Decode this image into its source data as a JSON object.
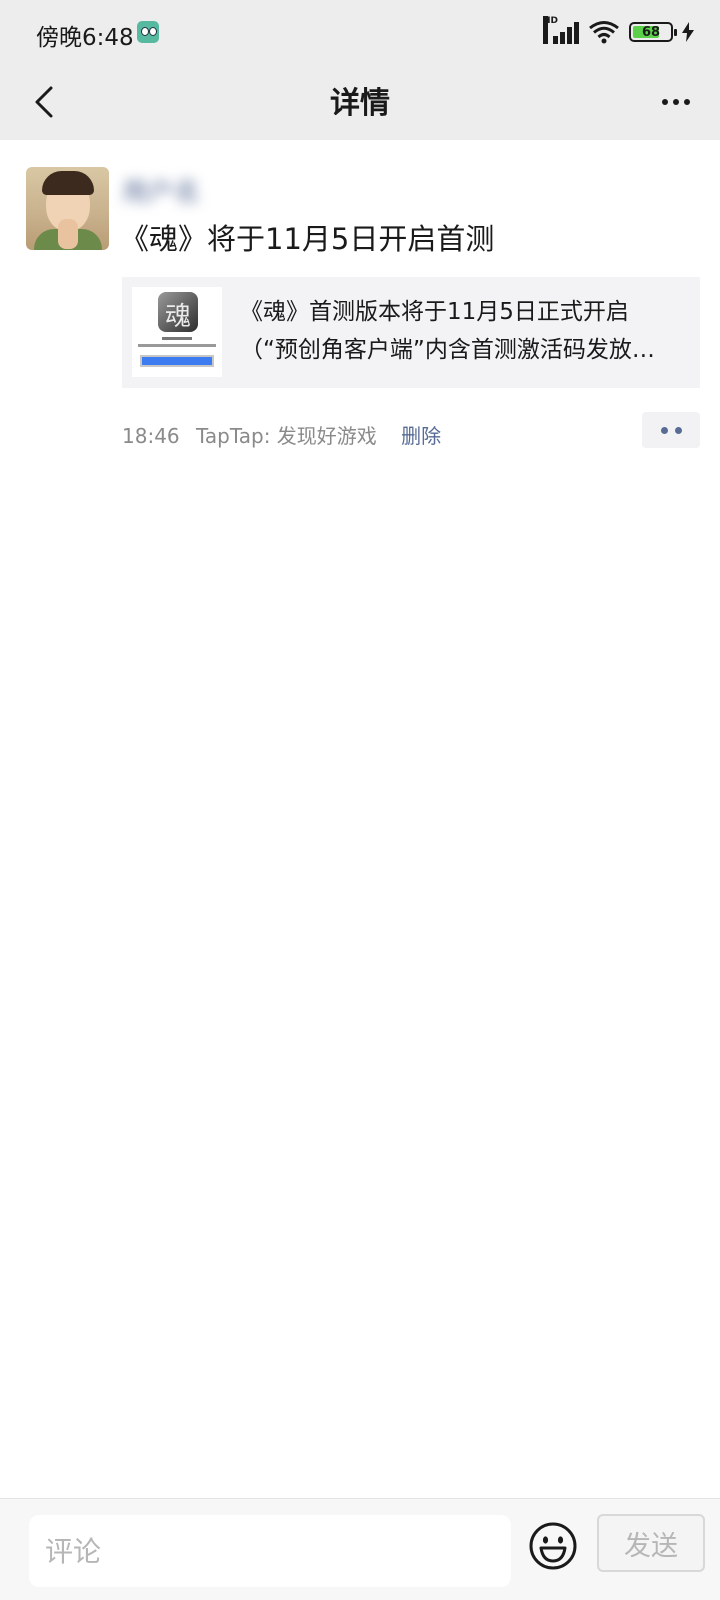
{
  "status_bar": {
    "time": "傍晚6:48",
    "network": "HD",
    "battery": "68"
  },
  "header": {
    "title": "详情"
  },
  "post": {
    "username": "用户名",
    "text": "《魂》将于11月5日开启首测",
    "link": {
      "title_line1": "《魂》首测版本将于11月5日正式开启",
      "title_line2": "（“预创角客户端”内含首测激活码发放…"
    },
    "time": "18:46",
    "source": "TapTap: 发现好游戏",
    "delete_label": "删除"
  },
  "comment_bar": {
    "placeholder": "评论",
    "send_label": "发送"
  },
  "icons": {
    "back": "chevron-left-icon",
    "more": "more-horizontal-icon",
    "action": "comment-like-icon",
    "emoji": "emoji-icon"
  },
  "colors": {
    "link_blue": "#576b95",
    "header_bg": "#ededed",
    "battery_green": "#5bd14a"
  }
}
